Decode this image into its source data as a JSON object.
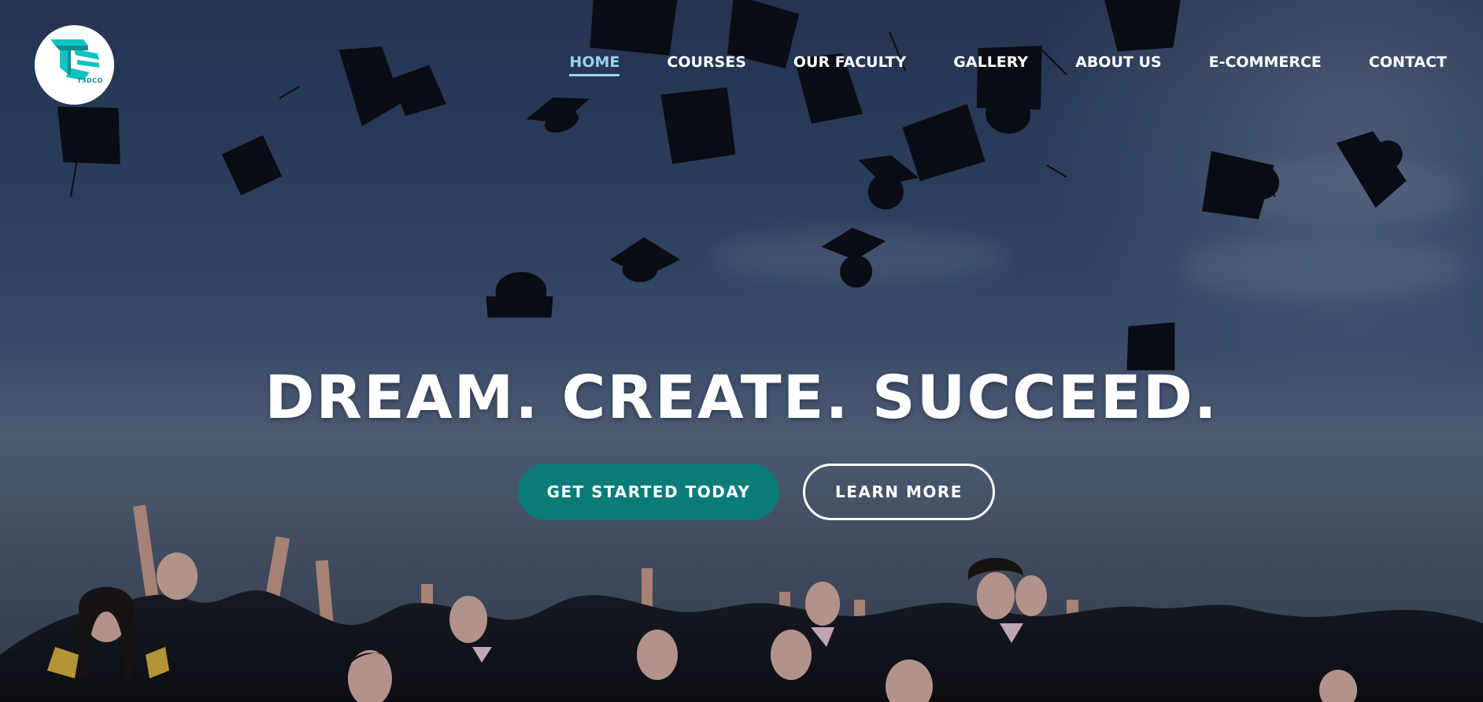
{
  "brand": {
    "logo_text": "T3DCO",
    "logo_color": "#12c3c3"
  },
  "nav": {
    "items": [
      {
        "label": "HOME",
        "active": true
      },
      {
        "label": "COURSES",
        "active": false
      },
      {
        "label": "OUR FACULTY",
        "active": false
      },
      {
        "label": "GALLERY",
        "active": false
      },
      {
        "label": "ABOUT US",
        "active": false
      },
      {
        "label": "E-COMMERCE",
        "active": false
      },
      {
        "label": "CONTACT",
        "active": false
      }
    ],
    "active_color": "#9ad3ee"
  },
  "hero": {
    "headline": "DREAM. CREATE. SUCCEED.",
    "primary_button": "GET STARTED TODAY",
    "secondary_button": "LEARN MORE",
    "primary_color": "#0a7c78",
    "background_description_icon": "graduation-caps-photo"
  }
}
